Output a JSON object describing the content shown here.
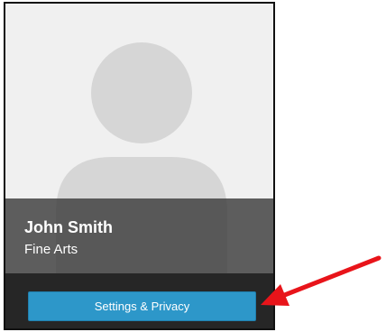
{
  "profile": {
    "name": "John Smith",
    "department": "Fine Arts",
    "avatar_icon": "person-silhouette-icon"
  },
  "actions": {
    "settings_label": "Settings & Privacy"
  },
  "annotation": {
    "arrow_icon": "red-arrow-icon",
    "arrow_color": "#e8141a"
  },
  "colors": {
    "button": "#2d97c9",
    "footer": "#262626",
    "photo_bg": "#f0f0f0",
    "silhouette": "#d6d6d6"
  }
}
